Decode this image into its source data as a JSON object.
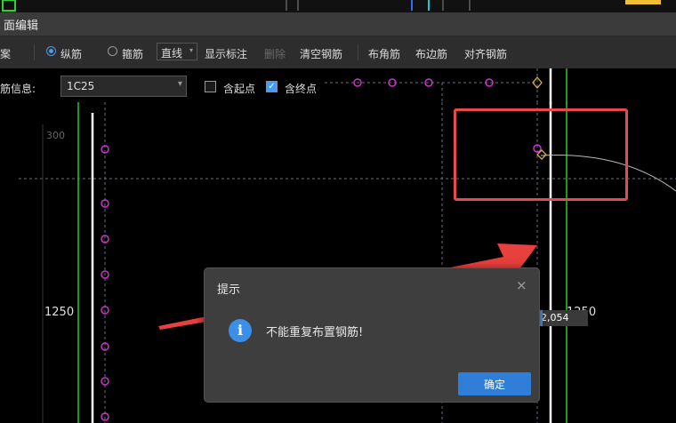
{
  "window": {
    "title": "面编辑"
  },
  "toolbar": {
    "left_cut": "案",
    "radio_longitudinal": "纵筋",
    "radio_stirrup": "箍筋",
    "line_mode": "直线",
    "show_dim": "显示标注",
    "delete": "删除",
    "clear_rebar": "清空钢筋",
    "corner_rebar": "布角筋",
    "side_rebar": "布边筋",
    "align_rebar": "对齐钢筋"
  },
  "infobar": {
    "rebar_info_label": "筋信息:",
    "rebar_info_value": "1C25",
    "start_point_label": "含起点",
    "end_point_label": "含终点",
    "start_point_checked": false,
    "end_point_checked": true
  },
  "canvas": {
    "dim_top_left": "300",
    "dim_left": "1250",
    "dim_right": "1250",
    "length_input": "2,054"
  },
  "message_box": {
    "title": "提示",
    "close_icon": "×",
    "info_glyph": "i",
    "text": "不能重复布置钢筋!",
    "ok_label": "确定"
  },
  "colors": {
    "accent": "#3b8fe8",
    "highlight": "#e44a4f",
    "rebar": "#cc33cc",
    "green_line": "#22cc22",
    "end_point": "#d4b23a"
  }
}
